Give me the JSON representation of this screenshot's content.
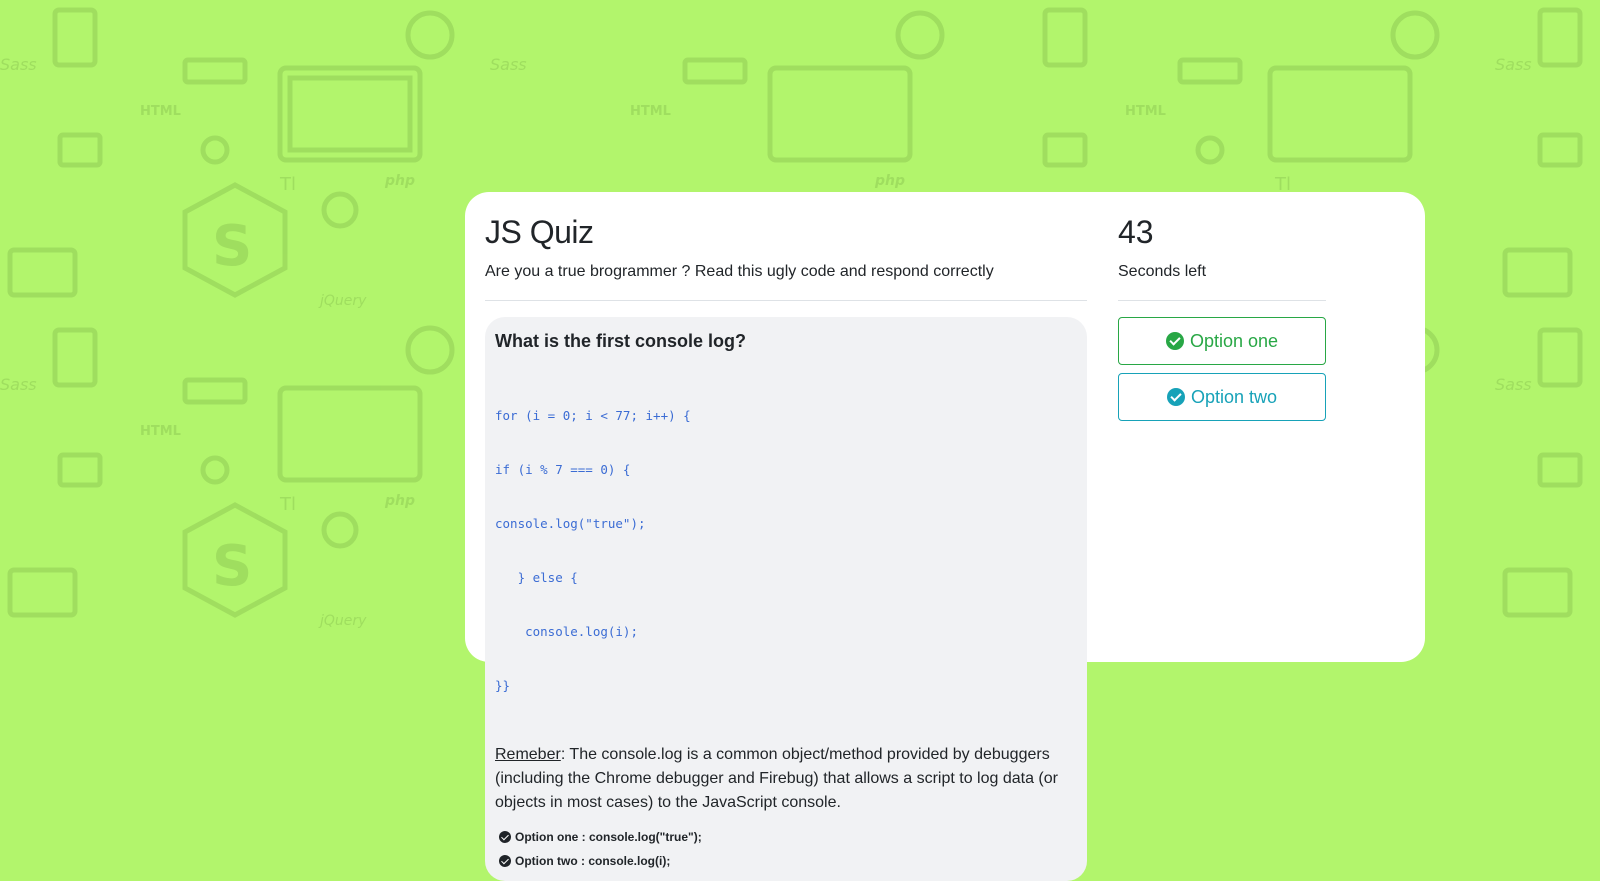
{
  "quiz": {
    "title": "JS Quiz",
    "subtitle": "Are you a true brogrammer ? Read this ugly code and respond correctly"
  },
  "question": {
    "title": "What is the first console log?",
    "code_lines": [
      "for (i = 0; i < 77; i++) {",
      "if (i % 7 === 0) {",
      "console.log(\"true\");",
      "   } else {",
      "    console.log(i);",
      "}}"
    ],
    "note_term": "Remeber",
    "note_text": ": The console.log is a common object/method provided by debuggers (including the Chrome debugger and Firebug) that allows a script to log data (or objects in most cases) to the JavaScript console.",
    "answers": [
      "Option one : console.log(\"true\");",
      "Option two : console.log(i);"
    ]
  },
  "timer": {
    "value": "43",
    "label": "Seconds left"
  },
  "options": [
    {
      "label": "Option one",
      "icon": "check-circle-icon",
      "color": "#28a745"
    },
    {
      "label": "Option two",
      "icon": "check-circle-icon",
      "color": "#17a2b8"
    }
  ],
  "colors": {
    "background": "#b2f56c",
    "card": "#ffffff",
    "panel": "#f1f2f4",
    "code": "#3b6cd4"
  }
}
